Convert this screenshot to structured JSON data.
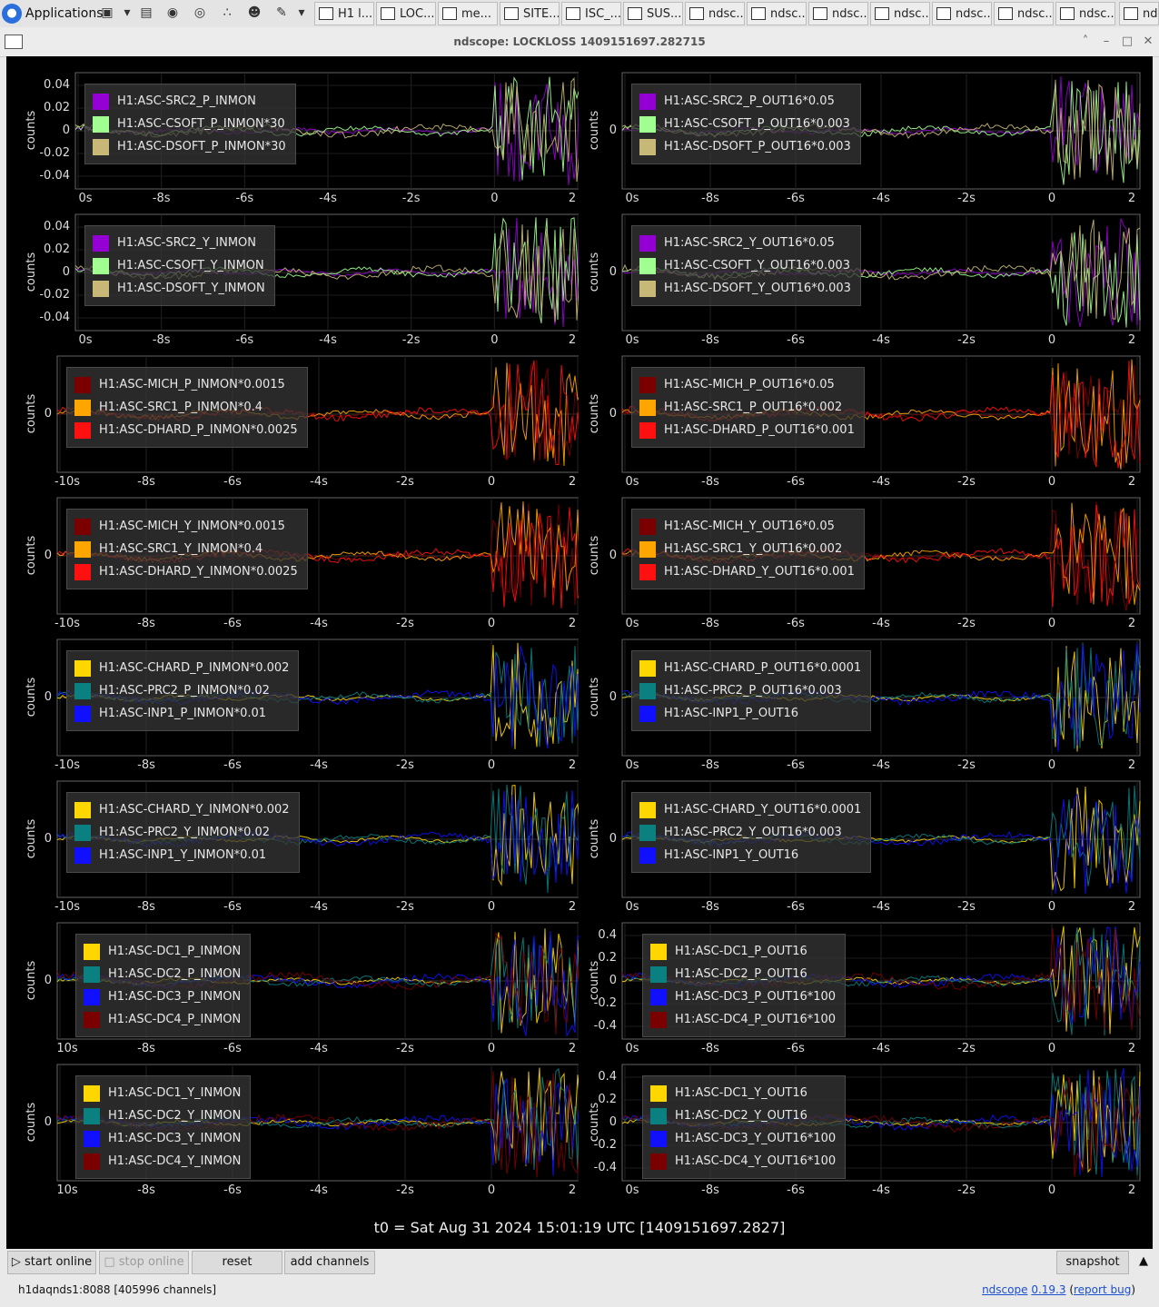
{
  "taskbar": {
    "apps_label": "Applications",
    "launchers": [
      "terminal-icon",
      "chevron-down-icon",
      "folder-icon",
      "firefox-icon",
      "chromium-icon",
      "share-icon",
      "users-icon",
      "notepad-icon",
      "chevron-down-icon"
    ],
    "tasks": [
      "H1 l...",
      "LOC...",
      "me...",
      "SITE...",
      "ISC_...",
      "SUS...",
      "ndsc...",
      "ndsc...",
      "ndsc...",
      "ndsc...",
      "ndsc...",
      "ndsc...",
      "ndsc...",
      "nd"
    ]
  },
  "window": {
    "title": "ndscope: LOCKLOSS 1409151697.282715",
    "controls": [
      "˄",
      "–",
      "□",
      "✕"
    ]
  },
  "colors": {
    "purple": "#9400d3",
    "lightgreen": "#a0ff90",
    "khaki": "#c8b878",
    "darkred": "#7a0000",
    "orange": "#ffa500",
    "red": "#ff1010",
    "gold": "#ffd700",
    "teal": "#0a8080",
    "blue": "#1010ff"
  },
  "y_axis_label": "counts",
  "plots": [
    {
      "col": 0,
      "row": 0,
      "yticks": [
        "0.04",
        "0.02",
        "0",
        "-0.02",
        "-0.04"
      ],
      "xticks": [
        "0s",
        "-8s",
        "-6s",
        "-4s",
        "-2s",
        "0",
        "2"
      ],
      "legend": [
        {
          "label": "H1:ASC-SRC2_P_INMON",
          "color": "#9400d3"
        },
        {
          "label": "H1:ASC-CSOFT_P_INMON*30",
          "color": "#a0ff90"
        },
        {
          "label": "H1:ASC-DSOFT_P_INMON*30",
          "color": "#c8b878"
        }
      ]
    },
    {
      "col": 1,
      "row": 0,
      "yticks": [
        "0"
      ],
      "xticks": [
        "0s",
        "-8s",
        "-6s",
        "-4s",
        "-2s",
        "0",
        "2"
      ],
      "legend": [
        {
          "label": "H1:ASC-SRC2_P_OUT16*0.05",
          "color": "#9400d3"
        },
        {
          "label": "H1:ASC-CSOFT_P_OUT16*0.003",
          "color": "#a0ff90"
        },
        {
          "label": "H1:ASC-DSOFT_P_OUT16*0.003",
          "color": "#c8b878"
        }
      ]
    },
    {
      "col": 0,
      "row": 1,
      "yticks": [
        "0.04",
        "0.02",
        "0",
        "-0.02",
        "-0.04"
      ],
      "xticks": [
        "0s",
        "-8s",
        "-6s",
        "-4s",
        "-2s",
        "0",
        "2"
      ],
      "legend": [
        {
          "label": "H1:ASC-SRC2_Y_INMON",
          "color": "#9400d3"
        },
        {
          "label": "H1:ASC-CSOFT_Y_INMON",
          "color": "#a0ff90"
        },
        {
          "label": "H1:ASC-DSOFT_Y_INMON",
          "color": "#c8b878"
        }
      ]
    },
    {
      "col": 1,
      "row": 1,
      "yticks": [
        "0"
      ],
      "xticks": [
        "0s",
        "-8s",
        "-6s",
        "-4s",
        "-2s",
        "0",
        "2"
      ],
      "legend": [
        {
          "label": "H1:ASC-SRC2_Y_OUT16*0.05",
          "color": "#9400d3"
        },
        {
          "label": "H1:ASC-CSOFT_Y_OUT16*0.003",
          "color": "#a0ff90"
        },
        {
          "label": "H1:ASC-DSOFT_Y_OUT16*0.003",
          "color": "#c8b878"
        }
      ]
    },
    {
      "col": 0,
      "row": 2,
      "yticks": [
        "0"
      ],
      "xticks": [
        "-10s",
        "-8s",
        "-6s",
        "-4s",
        "-2s",
        "0",
        "2"
      ],
      "legend": [
        {
          "label": "H1:ASC-MICH_P_INMON*0.0015",
          "color": "#7a0000"
        },
        {
          "label": "H1:ASC-SRC1_P_INMON*0.4",
          "color": "#ffa500"
        },
        {
          "label": "H1:ASC-DHARD_P_INMON*0.0025",
          "color": "#ff1010"
        }
      ]
    },
    {
      "col": 1,
      "row": 2,
      "yticks": [
        "0"
      ],
      "xticks": [
        "0s",
        "-8s",
        "-6s",
        "-4s",
        "-2s",
        "0",
        "2"
      ],
      "legend": [
        {
          "label": "H1:ASC-MICH_P_OUT16*0.05",
          "color": "#7a0000"
        },
        {
          "label": "H1:ASC-SRC1_P_OUT16*0.002",
          "color": "#ffa500"
        },
        {
          "label": "H1:ASC-DHARD_P_OUT16*0.001",
          "color": "#ff1010"
        }
      ]
    },
    {
      "col": 0,
      "row": 3,
      "yticks": [
        "0"
      ],
      "xticks": [
        "-10s",
        "-8s",
        "-6s",
        "-4s",
        "-2s",
        "0",
        "2"
      ],
      "legend": [
        {
          "label": "H1:ASC-MICH_Y_INMON*0.0015",
          "color": "#7a0000"
        },
        {
          "label": "H1:ASC-SRC1_Y_INMON*0.4",
          "color": "#ffa500"
        },
        {
          "label": "H1:ASC-DHARD_Y_INMON*0.0025",
          "color": "#ff1010"
        }
      ]
    },
    {
      "col": 1,
      "row": 3,
      "yticks": [
        "0"
      ],
      "xticks": [
        "0s",
        "-8s",
        "-6s",
        "-4s",
        "-2s",
        "0",
        "2"
      ],
      "legend": [
        {
          "label": "H1:ASC-MICH_Y_OUT16*0.05",
          "color": "#7a0000"
        },
        {
          "label": "H1:ASC-SRC1_Y_OUT16*0.002",
          "color": "#ffa500"
        },
        {
          "label": "H1:ASC-DHARD_Y_OUT16*0.001",
          "color": "#ff1010"
        }
      ]
    },
    {
      "col": 0,
      "row": 4,
      "yticks": [
        "0"
      ],
      "xticks": [
        "-10s",
        "-8s",
        "-6s",
        "-4s",
        "-2s",
        "0",
        "2"
      ],
      "legend": [
        {
          "label": "H1:ASC-CHARD_P_INMON*0.002",
          "color": "#ffd700"
        },
        {
          "label": "H1:ASC-PRC2_P_INMON*0.02",
          "color": "#0a8080"
        },
        {
          "label": "H1:ASC-INP1_P_INMON*0.01",
          "color": "#1010ff"
        }
      ]
    },
    {
      "col": 1,
      "row": 4,
      "yticks": [
        "0"
      ],
      "xticks": [
        "0s",
        "-8s",
        "-6s",
        "-4s",
        "-2s",
        "0",
        "2"
      ],
      "legend": [
        {
          "label": "H1:ASC-CHARD_P_OUT16*0.0001",
          "color": "#ffd700"
        },
        {
          "label": "H1:ASC-PRC2_P_OUT16*0.003",
          "color": "#0a8080"
        },
        {
          "label": "H1:ASC-INP1_P_OUT16",
          "color": "#1010ff"
        }
      ]
    },
    {
      "col": 0,
      "row": 5,
      "yticks": [
        "0"
      ],
      "xticks": [
        "-10s",
        "-8s",
        "-6s",
        "-4s",
        "-2s",
        "0",
        "2"
      ],
      "legend": [
        {
          "label": "H1:ASC-CHARD_Y_INMON*0.002",
          "color": "#ffd700"
        },
        {
          "label": "H1:ASC-PRC2_Y_INMON*0.02",
          "color": "#0a8080"
        },
        {
          "label": "H1:ASC-INP1_Y_INMON*0.01",
          "color": "#1010ff"
        }
      ]
    },
    {
      "col": 1,
      "row": 5,
      "yticks": [
        "0"
      ],
      "xticks": [
        "0s",
        "-8s",
        "-6s",
        "-4s",
        "-2s",
        "0",
        "2"
      ],
      "legend": [
        {
          "label": "H1:ASC-CHARD_Y_OUT16*0.0001",
          "color": "#ffd700"
        },
        {
          "label": "H1:ASC-PRC2_Y_OUT16*0.003",
          "color": "#0a8080"
        },
        {
          "label": "H1:ASC-INP1_Y_OUT16",
          "color": "#1010ff"
        }
      ]
    },
    {
      "col": 0,
      "row": 6,
      "yticks": [
        "0"
      ],
      "xticks": [
        "10s",
        "-8s",
        "-6s",
        "-4s",
        "-2s",
        "0",
        "2"
      ],
      "legend": [
        {
          "label": "H1:ASC-DC1_P_INMON",
          "color": "#ffd700"
        },
        {
          "label": "H1:ASC-DC2_P_INMON",
          "color": "#0a8080"
        },
        {
          "label": "H1:ASC-DC3_P_INMON",
          "color": "#1010ff"
        },
        {
          "label": "H1:ASC-DC4_P_INMON",
          "color": "#7a0000"
        }
      ]
    },
    {
      "col": 1,
      "row": 6,
      "yticks": [
        "0.4",
        "0.2",
        "0",
        "-0.2",
        "-0.4"
      ],
      "xticks": [
        "0s",
        "-8s",
        "-6s",
        "-4s",
        "-2s",
        "0",
        "2"
      ],
      "legend": [
        {
          "label": "H1:ASC-DC1_P_OUT16",
          "color": "#ffd700"
        },
        {
          "label": "H1:ASC-DC2_P_OUT16",
          "color": "#0a8080"
        },
        {
          "label": "H1:ASC-DC3_P_OUT16*100",
          "color": "#1010ff"
        },
        {
          "label": "H1:ASC-DC4_P_OUT16*100",
          "color": "#7a0000"
        }
      ]
    },
    {
      "col": 0,
      "row": 7,
      "yticks": [
        "0"
      ],
      "xticks": [
        "10s",
        "-8s",
        "-6s",
        "-4s",
        "-2s",
        "0",
        "2"
      ],
      "legend": [
        {
          "label": "H1:ASC-DC1_Y_INMON",
          "color": "#ffd700"
        },
        {
          "label": "H1:ASC-DC2_Y_INMON",
          "color": "#0a8080"
        },
        {
          "label": "H1:ASC-DC3_Y_INMON",
          "color": "#1010ff"
        },
        {
          "label": "H1:ASC-DC4_Y_INMON",
          "color": "#7a0000"
        }
      ]
    },
    {
      "col": 1,
      "row": 7,
      "yticks": [
        "0.4",
        "0.2",
        "0",
        "-0.2",
        "-0.4"
      ],
      "xticks": [
        "0s",
        "-8s",
        "-6s",
        "-4s",
        "-2s",
        "0",
        "2"
      ],
      "legend": [
        {
          "label": "H1:ASC-DC1_Y_OUT16",
          "color": "#ffd700"
        },
        {
          "label": "H1:ASC-DC2_Y_OUT16",
          "color": "#0a8080"
        },
        {
          "label": "H1:ASC-DC3_Y_OUT16*100",
          "color": "#1010ff"
        },
        {
          "label": "H1:ASC-DC4_Y_OUT16*100",
          "color": "#7a0000"
        }
      ]
    }
  ],
  "t0": "t0 = Sat Aug 31 2024 15:01:19 UTC [1409151697.2827]",
  "toolbar": {
    "start_online": "start online",
    "stop_online": "stop online",
    "reset": "reset",
    "add_channels": "add channels",
    "snapshot": "snapshot",
    "collapse": "▲"
  },
  "status": {
    "server": "h1daqnds1:8088  [405996 channels]",
    "app_name": "ndscope",
    "version": "0.19.3",
    "report_bug": "report bug"
  }
}
